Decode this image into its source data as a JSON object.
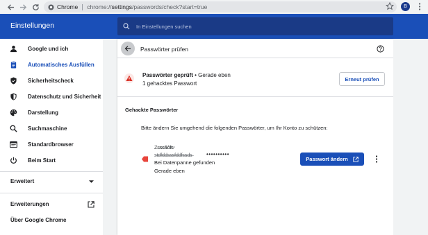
{
  "browser": {
    "site_name": "Chrome",
    "url_prefix": "chrome://",
    "url_bold": "settings",
    "url_rest": "/passwords/check?start=true",
    "avatar_letter": "B"
  },
  "header": {
    "title": "Einstellungen",
    "search_placeholder": "In Einstellungen suchen"
  },
  "sidebar": {
    "items": [
      {
        "label": "Google und ich",
        "icon": "person-icon"
      },
      {
        "label": "Automatisches Ausfüllen",
        "icon": "clipboard-icon",
        "active": true
      },
      {
        "label": "Sicherheitscheck",
        "icon": "shield-check-icon"
      },
      {
        "label": "Datenschutz und Sicherheit",
        "icon": "shield-icon"
      },
      {
        "label": "Darstellung",
        "icon": "palette-icon"
      },
      {
        "label": "Suchmaschine",
        "icon": "search-icon"
      },
      {
        "label": "Standardbrowser",
        "icon": "browser-icon"
      },
      {
        "label": "Beim Start",
        "icon": "power-icon"
      }
    ],
    "advanced_label": "Erweitert",
    "extensions_label": "Erweiterungen",
    "about_label": "Über Google Chrome"
  },
  "main": {
    "title": "Passwörter prüfen",
    "status_checked": "Passwörter geprüft",
    "status_time": " • Gerade eben",
    "status_count": "1 gehacktes Passwort",
    "recheck_button": "Erneut prüfen",
    "section_title": "Gehackte Passwörter",
    "instruction": "Bitte ändern Sie umgehend die folgenden Passwörter, um Ihr Konto zu schützen:",
    "leak": {
      "site": "Zs̷s̷s̷ã̷ô̷f̷s̷",
      "username": "s̶t̶d̶f̶d̶d̶s̶s̶s̶f̶d̶d̶f̶s̶s̶d̶s̶",
      "password": "••••••••••",
      "reason": "Bei Datenpanne gefunden",
      "time": "Gerade eben",
      "change_button": "Passwort ändern"
    }
  },
  "colors": {
    "header_blue": "#1a4fb8",
    "accent_blue": "#1a4fb8",
    "warning_red": "#d93025"
  }
}
